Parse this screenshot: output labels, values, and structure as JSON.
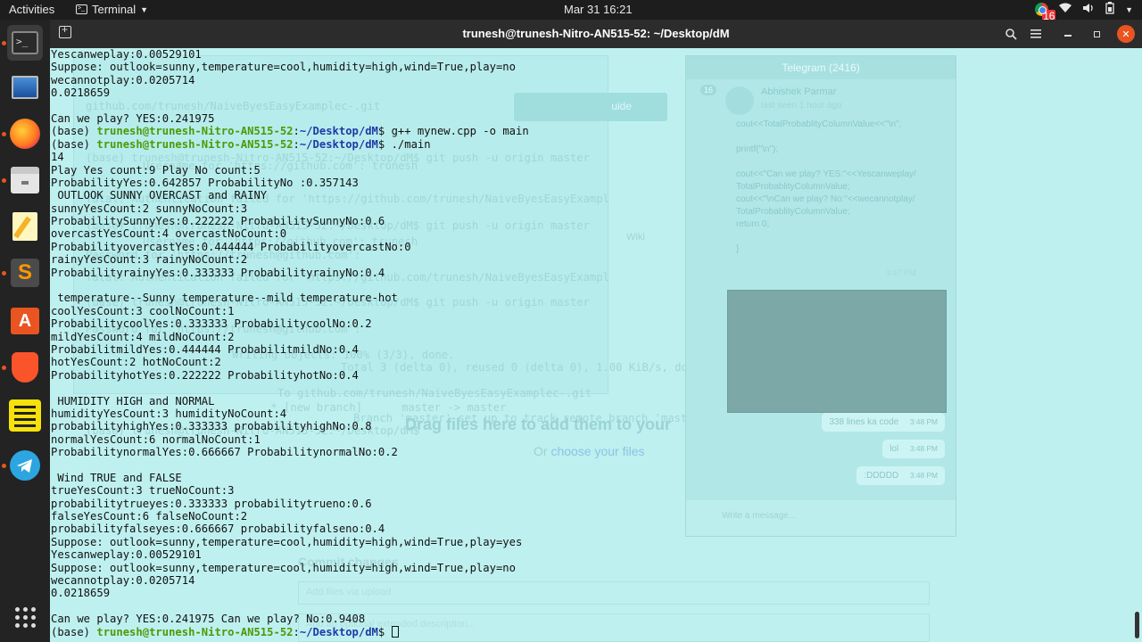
{
  "topbar": {
    "activities": "Activities",
    "app_name": "Terminal",
    "clock": "Mar 31  16:21",
    "chrome_badge": "16"
  },
  "window": {
    "title": "trunesh@trunesh-Nitro-AN515-52: ~/Desktop/dM"
  },
  "dock": {
    "items": [
      "terminal",
      "display-settings",
      "firefox",
      "files",
      "text-editor",
      "sublime-text",
      "ubuntu-software",
      "brave",
      "notes",
      "telegram",
      "show-applications"
    ]
  },
  "background": {
    "ghost_lines": [
      "github.com/trunesh/NaiveByesEasyExamplec-.git",
      "(base) trunesh@trunesh-Nitro-AN515-52:~/Desktop/dM$ git push -u origin master",
      "Username for 'https://github.com': trunesh",
      "fatal: Authentication failed for 'https://github.com/trunesh/NaiveByesEasyExampl",
      "(base) trunesh@trunesh-Nitro-AN515-52:~/Desktop/dM$ git push -u origin master",
      "Username for 'https://github.com': trunesh",
      "Password for 'https://trunesh@github.com':",
      "fatal: Authentication failed for 'https://github.com/trunesh/NaiveByesEasyExampl",
      "(base) trunesh@trunesh-Nitro-AN515-52:~/Desktop/dM$ git push -u origin master",
      "Password for 'https://trunesh@github.com':",
      "Writing objects: 100% (3/3), done.",
      "Total 3 (delta 0), reused 0 (delta 0), 1.00 KiB/s, done.",
      "To github.com/trunesh/NaiveByesEasyExamplec-.git",
      " * [new branch]      master -> master",
      "Branch 'master' set up to track remote branch 'master' from 'origin'.",
      "(base) trunesh@trunesh-Nitro-AN515-52:~/Desktop/dM$"
    ],
    "telegram": {
      "title": "Telegram (2416)",
      "badge": "16",
      "contact": "Abhishek Parmar",
      "last_seen": "last seen 1 hour ago",
      "code_lines": [
        "cout<<TotalProbablityColumnValue<<\"\\n\";",
        "",
        "printf(\"\\n\");",
        "",
        "cout<<\"Can we play? YES:\"<<Yescanweplay/",
        "TotalProbablityColumnValue;",
        "cout<<\"\\nCan we play? No:\"<<wecannotplay/",
        "TotalProbablityColumnValue;",
        "return 0;",
        "",
        "}"
      ],
      "code_time": "3:47 PM",
      "bubbles": [
        {
          "text": "338 lines ka code",
          "time": "3:48 PM"
        },
        {
          "text": "lol",
          "time": "3:48 PM"
        },
        {
          "text": ":DDDDD",
          "time": "3:48 PM"
        }
      ],
      "input_placeholder": "Write a message..."
    },
    "github": {
      "drop_text": "Drag files here to add them to your",
      "choose_prefix": "Or",
      "choose_link": "choose your files",
      "commit_heading": "Commit changes",
      "commit_placeholder": "Add files via upload",
      "description_placeholder": "Add an optional extended description...",
      "guide_button": "uide",
      "wiki_tab": "Wiki"
    }
  },
  "terminal": {
    "prompt_user": "trunesh@trunesh-Nitro-AN515-52",
    "prompt_path": "~/Desktop/dM",
    "lines": [
      {
        "t": "Yescanweplay:0.00529101"
      },
      {
        "t": "Suppose: outlook=sunny,temperature=cool,humidity=high,wind=True,play=no"
      },
      {
        "t": "wecannotplay:0.0205714"
      },
      {
        "t": "0.0218659"
      },
      {
        "t": ""
      },
      {
        "t": "Can we play? YES:0.241975"
      },
      {
        "p": true,
        "cmd": " g++ mynew.cpp -o main"
      },
      {
        "p": true,
        "cmd": " ./main"
      },
      {
        "t": "14"
      },
      {
        "t": "Play Yes count:9 Play No count:5"
      },
      {
        "t": "ProbabilityYes:0.642857 ProbabilityNo :0.357143"
      },
      {
        "t": " OUTLOOK SUNNY OVERCAST and RAINY"
      },
      {
        "t": "sunnyYesCount:2 sunnyNoCount:3"
      },
      {
        "t": "ProbabilitySunnyYes:0.222222 ProbabilitySunnyNo:0.6"
      },
      {
        "t": "overcastYesCount:4 overcastNoCount:0"
      },
      {
        "t": "ProbabilityovercastYes:0.444444 ProbabilityovercastNo:0"
      },
      {
        "t": "rainyYesCount:3 rainyNoCount:2"
      },
      {
        "t": "ProbabilityrainyYes:0.333333 ProbabilityrainyNo:0.4"
      },
      {
        "t": ""
      },
      {
        "t": " temperature--Sunny temperature--mild temperature-hot"
      },
      {
        "t": "coolYesCount:3 coolNoCount:1"
      },
      {
        "t": "ProbabilitycoolYes:0.333333 ProbabilitycoolNo:0.2"
      },
      {
        "t": "mildYesCount:4 mildNoCount:2"
      },
      {
        "t": "ProbabilitmildYes:0.444444 ProbabilitmildNo:0.4"
      },
      {
        "t": "hotYesCount:2 hotNoCount:2"
      },
      {
        "t": "ProbabilityhotYes:0.222222 ProbabilityhotNo:0.4"
      },
      {
        "t": ""
      },
      {
        "t": " HUMIDITY HIGH and NORMAL"
      },
      {
        "t": "humidityYesCount:3 humidityNoCount:4"
      },
      {
        "t": "probabilityhighYes:0.333333 probabilityhighNo:0.8"
      },
      {
        "t": "normalYesCount:6 normalNoCount:1"
      },
      {
        "t": "ProbabilitynormalYes:0.666667 ProbabilitynormalNo:0.2"
      },
      {
        "t": ""
      },
      {
        "t": " Wind TRUE and FALSE"
      },
      {
        "t": "trueYesCount:3 trueNoCount:3"
      },
      {
        "t": "probabilitytrueyes:0.333333 probabilitytrueno:0.6"
      },
      {
        "t": "falseYesCount:6 falseNoCount:2"
      },
      {
        "t": "probabilityfalseyes:0.666667 probabilityfalseno:0.4"
      },
      {
        "t": "Suppose: outlook=sunny,temperature=cool,humidity=high,wind=True,play=yes"
      },
      {
        "t": "Yescanweplay:0.00529101"
      },
      {
        "t": "Suppose: outlook=sunny,temperature=cool,humidity=high,wind=True,play=no"
      },
      {
        "t": "wecannotplay:0.0205714"
      },
      {
        "t": "0.0218659"
      },
      {
        "t": ""
      },
      {
        "t": "Can we play? YES:0.241975 Can we play? No:0.9408"
      },
      {
        "p": true,
        "cmd": " ",
        "cursor": true
      }
    ]
  },
  "colors": {
    "terminal_bg": "#bff0f0",
    "prompt_user": "#4c9a06",
    "prompt_path": "#1e3aa8",
    "accent": "#e95420"
  }
}
